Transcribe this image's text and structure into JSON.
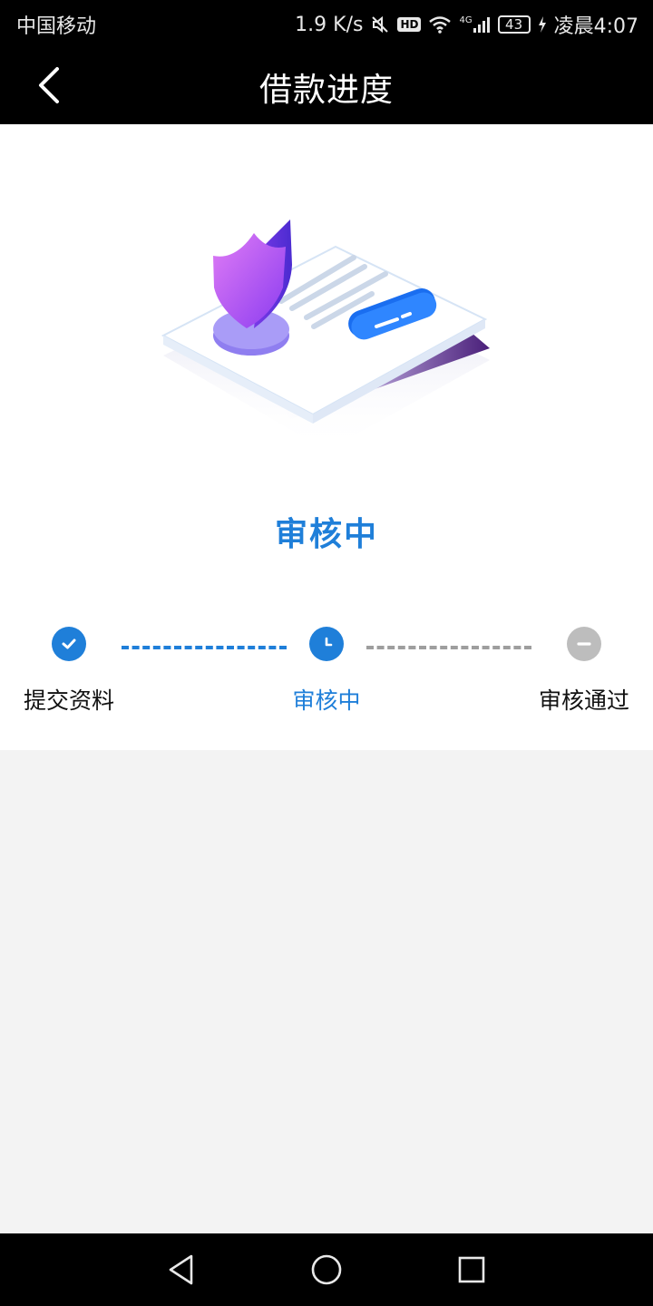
{
  "status_bar": {
    "carrier": "中国移动",
    "net_speed": "1.9 K/s",
    "hd_badge": "HD",
    "network_type": "4G",
    "battery": "43",
    "time": "凌晨4:07"
  },
  "header": {
    "title": "借款进度"
  },
  "main": {
    "status_heading": "审核中"
  },
  "steps": [
    {
      "label": "提交资料",
      "state": "done",
      "color": "#1f7fd9"
    },
    {
      "label": "审核中",
      "state": "current",
      "color": "#1f7fd9"
    },
    {
      "label": "审核通过",
      "state": "pending",
      "color": "#bdbdbd"
    }
  ],
  "colors": {
    "accent": "#1f7fd9",
    "pending": "#bdbdbd",
    "header_bg": "#000000",
    "page_bg": "#f3f3f3"
  }
}
